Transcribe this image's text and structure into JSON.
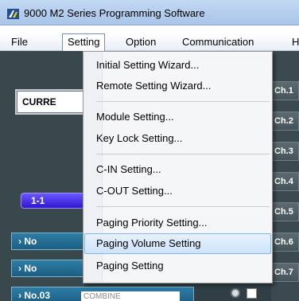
{
  "window": {
    "title": "9000 M2 Series Programming Software"
  },
  "menubar": {
    "items": [
      {
        "label": "File"
      },
      {
        "label": "Setting"
      },
      {
        "label": "Option"
      },
      {
        "label": "Communication"
      },
      {
        "label": "H"
      }
    ]
  },
  "background": {
    "current_box": "CURRE",
    "group_pill": "1-1",
    "rows": [
      "No",
      "No"
    ],
    "row_full": "No.03",
    "combine_placeholder": "COMBINE",
    "channels": [
      "Ch.1",
      "Ch.2",
      "Ch.3",
      "Ch.4",
      "Ch.5",
      "Ch.6",
      "Ch.7"
    ]
  },
  "setting_menu": {
    "items": [
      {
        "label": "Initial Setting Wizard..."
      },
      {
        "label": "Remote Setting Wizard..."
      },
      {
        "label": "Module Setting..."
      },
      {
        "label": "Key Lock Setting..."
      },
      {
        "label": "C-IN Setting..."
      },
      {
        "label": "C-OUT Setting..."
      },
      {
        "label": "Paging Priority Setting..."
      },
      {
        "label": "Paging Volume Setting"
      },
      {
        "label": "Paging Setting"
      }
    ],
    "highlighted": "Paging Volume Setting"
  },
  "colors": {
    "highlight": "#cfe4fa",
    "accent_blue": "#2d7da7",
    "pill_purple": "#3a22e0"
  }
}
